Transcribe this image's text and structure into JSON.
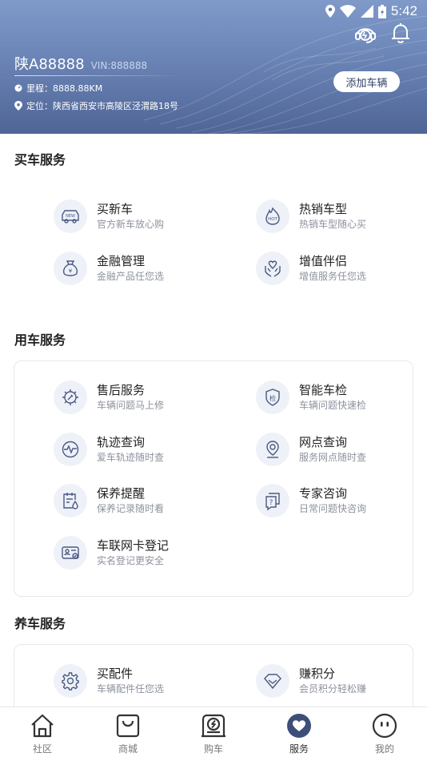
{
  "status_bar": {
    "time": "5:42"
  },
  "header": {
    "plate": "陕A88888",
    "vin": "VIN:888888",
    "mileage": "里程：8888.88KM",
    "location": "定位：陕西省西安市高陵区泾渭路18号",
    "add_vehicle_label": "添加车辆"
  },
  "sections": {
    "buy": {
      "title": "买车服务",
      "items": [
        {
          "title": "买新车",
          "subtitle": "官方新车放心购",
          "icon": "new-car-icon"
        },
        {
          "title": "热销车型",
          "subtitle": "热销车型随心买",
          "icon": "hot-icon"
        },
        {
          "title": "金融管理",
          "subtitle": "金融产品任您选",
          "icon": "money-bag-icon"
        },
        {
          "title": "增值伴侣",
          "subtitle": "增值服务任您选",
          "icon": "heart-hands-icon"
        }
      ]
    },
    "use": {
      "title": "用车服务",
      "items": [
        {
          "title": "售后服务",
          "subtitle": "车辆问题马上修",
          "icon": "gear-wrench-icon"
        },
        {
          "title": "智能车检",
          "subtitle": "车辆问题快速检",
          "icon": "shield-check-icon"
        },
        {
          "title": "轨迹查询",
          "subtitle": "爱车轨迹随时查",
          "icon": "pulse-icon"
        },
        {
          "title": "网点查询",
          "subtitle": "服务网点随时查",
          "icon": "location-pin-icon"
        },
        {
          "title": "保养提醒",
          "subtitle": "保养记录随时看",
          "icon": "calendar-drop-icon"
        },
        {
          "title": "专家咨询",
          "subtitle": "日常问题快咨询",
          "icon": "question-chat-icon"
        },
        {
          "title": "车联网卡登记",
          "subtitle": "实名登记更安全",
          "icon": "id-card-icon"
        }
      ]
    },
    "maintain": {
      "title": "养车服务",
      "items": [
        {
          "title": "买配件",
          "subtitle": "车辆配件任您选",
          "icon": "gear-icon"
        },
        {
          "title": "赚积分",
          "subtitle": "会员积分轻松赚",
          "icon": "diamond-icon"
        }
      ]
    }
  },
  "bottom_nav": [
    {
      "label": "社区",
      "icon": "home-icon",
      "active": false
    },
    {
      "label": "商城",
      "icon": "shopping-bag-icon",
      "active": false
    },
    {
      "label": "购车",
      "icon": "car-purchase-icon",
      "active": false
    },
    {
      "label": "服务",
      "icon": "heart-service-icon",
      "active": true
    },
    {
      "label": "我的",
      "icon": "face-icon",
      "active": false
    }
  ],
  "colors": {
    "header_top": "#7f9ac9",
    "header_bottom": "#4f6596",
    "icon_stroke": "#4a5a82",
    "icon_bg": "#eef1f8"
  }
}
